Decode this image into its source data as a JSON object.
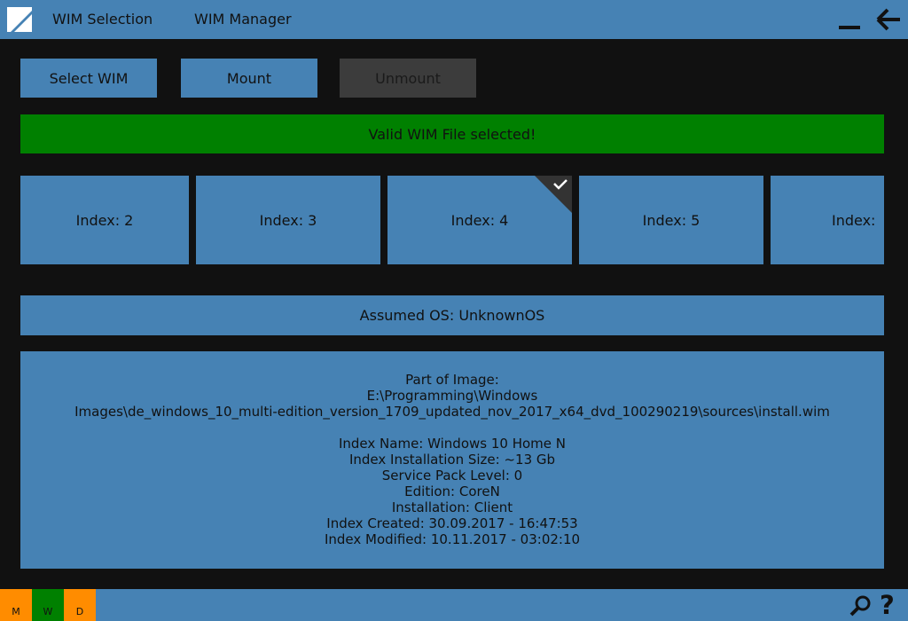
{
  "nav": {
    "wim_selection": "WIM Selection",
    "wim_manager": "WIM Manager"
  },
  "buttons": {
    "select_wim": "Select WIM",
    "mount": "Mount",
    "unmount": "Unmount"
  },
  "status": {
    "text": "Valid WIM File selected!",
    "color": "#008000"
  },
  "indices": [
    {
      "label": "Index: 2",
      "selected": false
    },
    {
      "label": "Index: 3",
      "selected": false
    },
    {
      "label": "Index: 4",
      "selected": true
    },
    {
      "label": "Index: 5",
      "selected": false
    },
    {
      "label": "Index:",
      "selected": false
    }
  ],
  "assumed_os": "Assumed OS: UnknownOS",
  "details": {
    "part_of_image_label": "Part of Image:",
    "path_line1": "E:\\Programming\\Windows",
    "path_line2": "Images\\de_windows_10_multi-edition_version_1709_updated_nov_2017_x64_dvd_100290219\\sources\\install.wim",
    "index_name": "Index Name: Windows 10 Home N",
    "install_size": "Index Installation Size: ~13 Gb",
    "service_pack": "Service Pack Level: 0",
    "edition": "Edition: CoreN",
    "installation": "Installation: Client",
    "created": "Index Created: 30.09.2017 - 16:47:53",
    "modified": "Index Modified: 10.11.2017 - 03:02:10"
  },
  "status_tags": [
    {
      "letter": "M",
      "color": "#ff8c00"
    },
    {
      "letter": "W",
      "color": "#008000"
    },
    {
      "letter": "D",
      "color": "#ff8c00"
    }
  ],
  "icons": {
    "logo": "app-logo-icon",
    "minimize": "minimize-icon",
    "back": "back-arrow-icon",
    "search": "search-icon",
    "help": "help-icon"
  },
  "colors": {
    "accent": "#4682b4",
    "background": "#111111",
    "disabled": "#3c3c3c"
  }
}
